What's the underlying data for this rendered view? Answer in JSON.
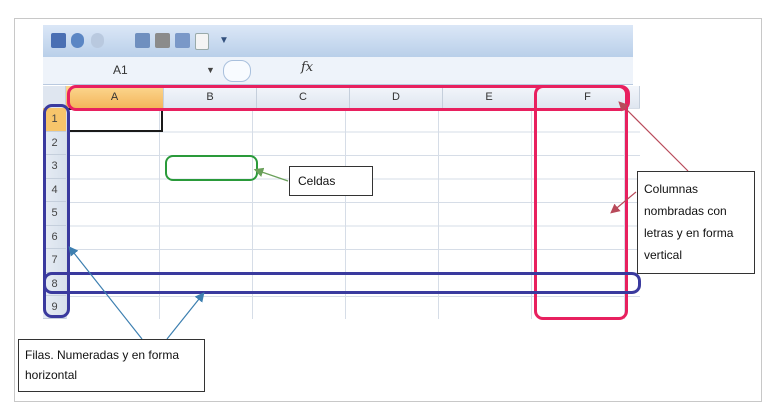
{
  "toolbar": {
    "icons": [
      "save-icon",
      "undo-icon",
      "redo-icon",
      "print-preview-icon",
      "print-icon",
      "spelling-icon",
      "new-icon",
      "customize-icon"
    ]
  },
  "formula_bar": {
    "name_box": "A1",
    "fx_label": "fx"
  },
  "sheet": {
    "columns": [
      "A",
      "B",
      "C",
      "D",
      "E",
      "F"
    ],
    "rows": [
      "1",
      "2",
      "3",
      "4",
      "5",
      "6",
      "7",
      "8",
      "9"
    ],
    "active_cell": "A1"
  },
  "annotations": {
    "celdas": "Celdas",
    "columnas": "Columnas nombradas con letras y en forma vertical",
    "filas": "Filas. Numeradas y en forma horizontal"
  },
  "colors": {
    "columns_highlight": "#e8205f",
    "cells_highlight": "#2a9a3a",
    "rows_highlight": "#3a3a9e",
    "pointer": "#3d7fb0"
  }
}
